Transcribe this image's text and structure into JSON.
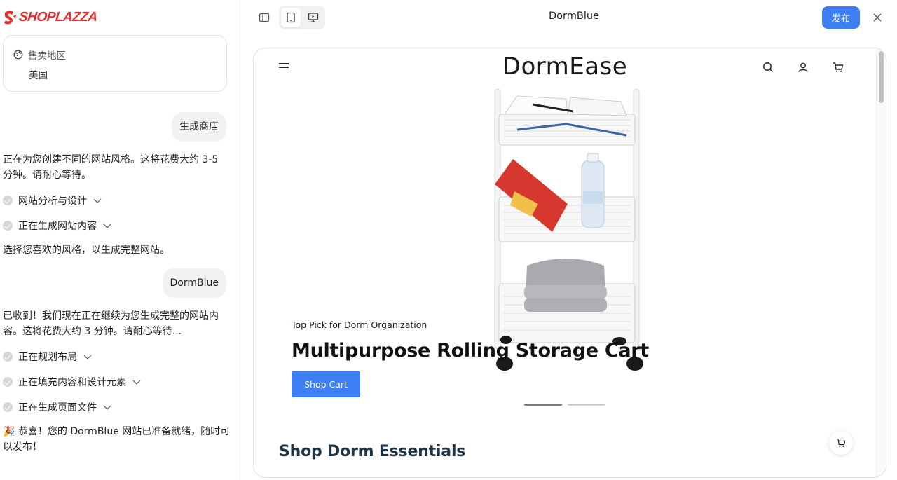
{
  "brand": {
    "name": "SHOPLAZZA",
    "color": "#e52b2b"
  },
  "region": {
    "label": "售卖地区",
    "value": "美国"
  },
  "chat": {
    "user_msg_1": "生成商店",
    "ai_msg_1": "正在为您创建不同的网站风格。这将花费大约 3-5 分钟。请耐心等待。",
    "step_1": "网站分析与设计",
    "step_2": "正在生成网站内容",
    "ai_msg_2": "选择您喜欢的风格，以生成完整网站。",
    "user_msg_2": "DormBlue",
    "ai_msg_3": "已收到！我们现在正在继续为您生成完整的网站内容。这将花费大约 3 分钟。请耐心等待...",
    "step_3": "正在规划布局",
    "step_4": "正在填充内容和设计元素",
    "step_5": "正在生成页面文件",
    "ai_msg_4": "🎉 恭喜！您的 DormBlue 网站已准备就绪，随时可以发布！"
  },
  "topbar": {
    "title": "DormBlue",
    "publish_label": "发布",
    "accent": "#3d7ef5"
  },
  "preview": {
    "site_name": "DormEase",
    "hero": {
      "kicker": "Top Pick for Dorm Organization",
      "title": "Multipurpose Rolling Storage Cart",
      "button": "Shop Cart"
    },
    "slides_total": 2,
    "slide_active": 1,
    "section_title": "Shop Dorm Essentials"
  }
}
